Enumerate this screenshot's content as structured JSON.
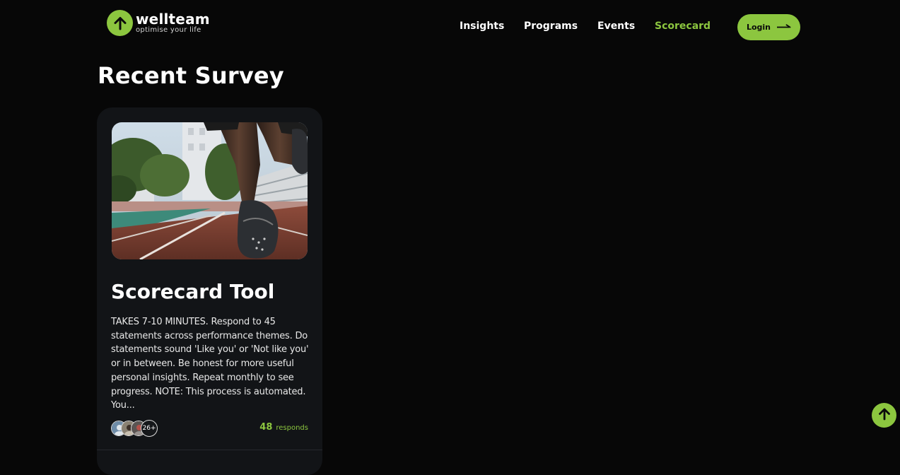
{
  "brand": {
    "name": "wellteam",
    "tagline": "optimise your life",
    "logo_icon": "arrow-up-icon",
    "accent": "#8cc63f"
  },
  "nav": {
    "items": [
      {
        "label": "Insights",
        "active": false
      },
      {
        "label": "Programs",
        "active": false
      },
      {
        "label": "Events",
        "active": false
      },
      {
        "label": "Scorecard",
        "active": true
      }
    ],
    "login_label": "Login",
    "login_icon": "long-arrow-right-icon"
  },
  "page": {
    "title": "Recent Survey"
  },
  "survey_card": {
    "image": "running-track-photo",
    "title": "Scorecard Tool",
    "description": "TAKES 7-10 MINUTES. Respond to 45 statements across performance themes. Do statements sound 'Like you' or 'Not like you' or in between. Be honest for more useful personal insights. Repeat monthly to see progress. NOTE: This process is automated. You...",
    "extra_participants": "26+",
    "responds_count": "48",
    "responds_label": "responds"
  },
  "scroll_top_icon": "arrow-up-icon"
}
